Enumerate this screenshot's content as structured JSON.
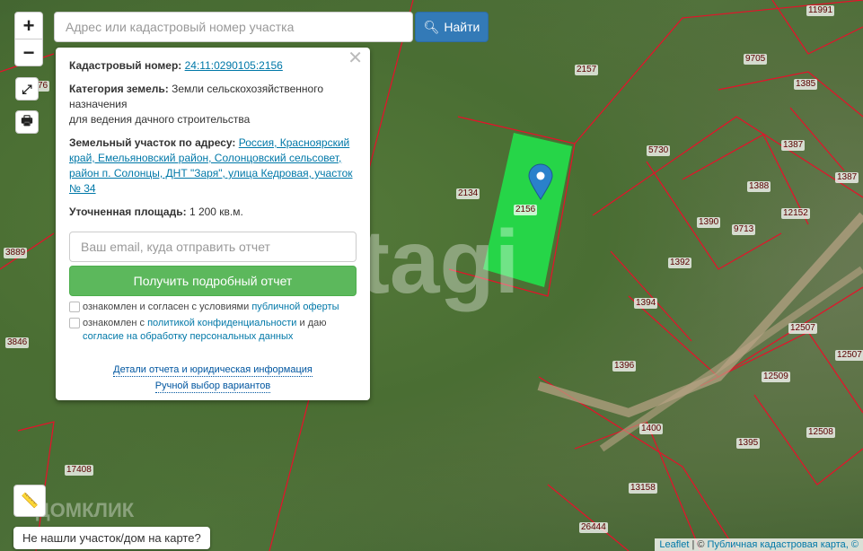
{
  "search": {
    "placeholder": "Адрес или кадастровый номер участка",
    "button": "Найти"
  },
  "controls": {
    "zoom_in": "+",
    "zoom_out": "−"
  },
  "popup": {
    "cadastral_label": "Кадастровый номер:",
    "cadastral_value": "24:11:0290105:2156",
    "category_label": "Категория земель:",
    "category_value": "Земли сельскохозяйственного назначения",
    "category_use": "для ведения дачного строительства",
    "address_label": "Земельный участок по адресу:",
    "address_value": "Россия, Красноярский край, Емельяновский район, Солонцовский сельсовет, район п. Солонцы, ДНТ \"Заря\", улица Кедровая, участок № 34",
    "area_label": "Уточненная площадь:",
    "area_value": "1 200 кв.м.",
    "email_placeholder": "Ваш email, куда отправить отчет",
    "report_button": "Получить подробный отчет",
    "consent1_text": "ознакомлен и согласен с условиями ",
    "consent1_link": "публичной оферты",
    "consent2_text": "ознакомлен с ",
    "consent2_link": "политикой конфиденциальности",
    "consent2_mid": " и даю ",
    "consent2_link2": "согласие на обработку персональных данных",
    "details_link": "Детали отчета и юридическая информация",
    "manual_link": "Ручной выбор вариантов"
  },
  "map": {
    "parcel_labels": [
      "2157",
      "9705",
      "1385",
      "5730",
      "1387",
      "2134",
      "2156",
      "1388",
      "1387",
      "12152",
      "1390",
      "9713",
      "1392",
      "1394",
      "12507",
      "1396",
      "12509",
      "12507",
      "1400",
      "1395",
      "12508",
      "13158",
      "17408",
      "3889",
      "3846",
      "26444",
      "11991",
      "76"
    ],
    "selected_parcel_color": "#22e04a",
    "parcel_border_color": "#e8102a",
    "watermark": "etagi",
    "logo": "ДОМКЛИК"
  },
  "not_found": "Не нашли участок/дом на карте?",
  "attribution": {
    "leaflet": "Leaflet",
    "separator": " | © ",
    "source": "Публичная кадастровая карта, ©"
  }
}
